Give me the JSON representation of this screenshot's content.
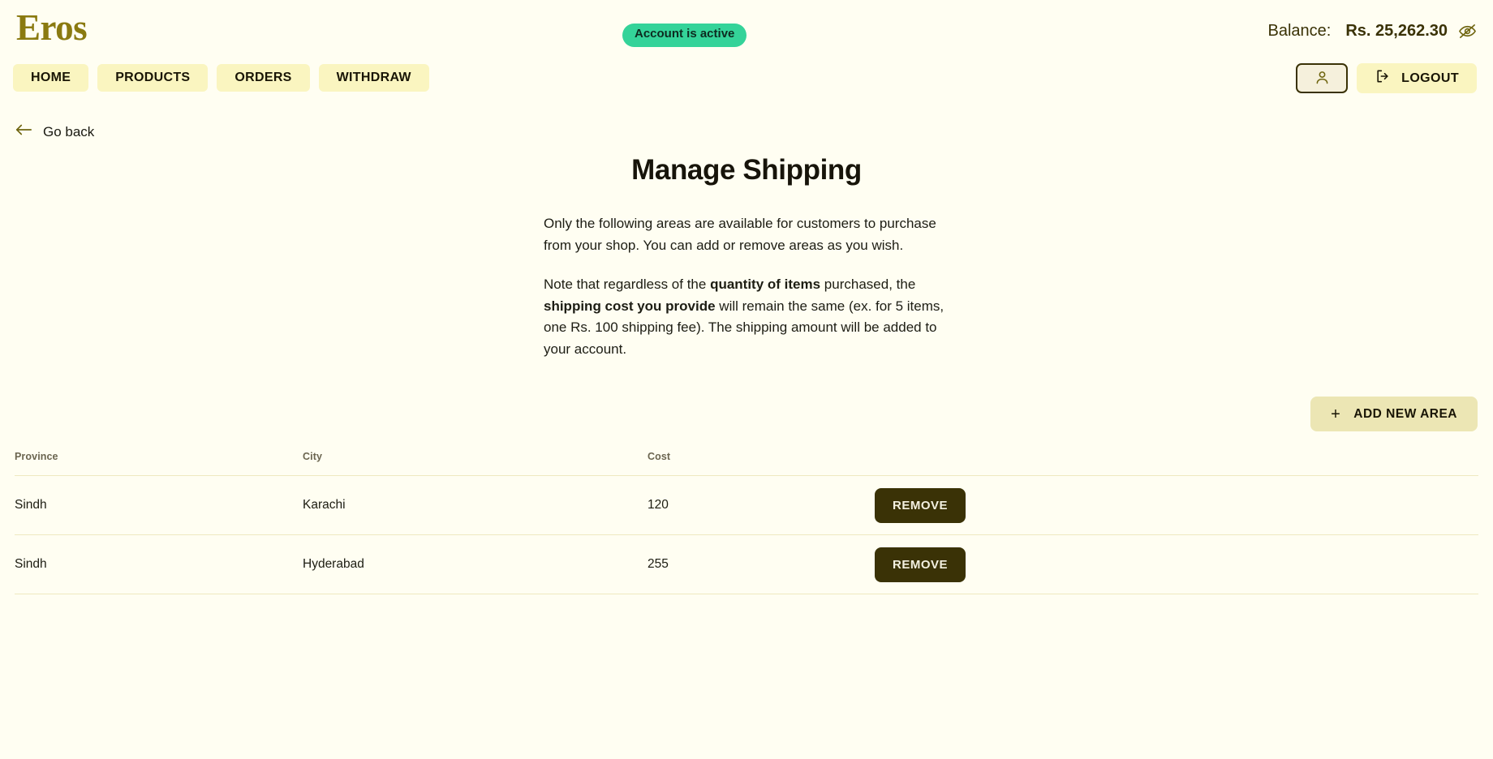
{
  "brand": "Eros",
  "header": {
    "status_badge": "Account is active",
    "balance_label": "Balance:",
    "balance_amount": "Rs. 25,262.30",
    "hide_balance_icon": "eye-off-icon",
    "nav": [
      {
        "label": "HOME"
      },
      {
        "label": "PRODUCTS"
      },
      {
        "label": "ORDERS"
      },
      {
        "label": "WITHDRAW"
      }
    ],
    "profile_icon": "user-icon",
    "logout_label": "LOGOUT",
    "logout_icon": "logout-icon"
  },
  "back": {
    "label": "Go back",
    "icon": "arrow-left-icon"
  },
  "main": {
    "title": "Manage Shipping",
    "paragraph1": "Only the following areas are available for customers to purchase from your shop. You can add or remove areas as you wish.",
    "paragraph2": {
      "part1": "Note that regardless of the ",
      "bold1": "quantity of items",
      "part2": " purchased, the ",
      "bold2": "shipping cost you provide",
      "part3": " will remain the same (ex. for 5 items, one Rs. 100 shipping fee). The shipping amount will be added to your account."
    },
    "add_area_label": "ADD NEW AREA",
    "add_area_icon": "plus-icon"
  },
  "table": {
    "columns": {
      "province": "Province",
      "city": "City",
      "cost": "Cost"
    },
    "rows": [
      {
        "province": "Sindh",
        "city": "Karachi",
        "cost": "120",
        "action": "REMOVE"
      },
      {
        "province": "Sindh",
        "city": "Hyderabad",
        "cost": "255",
        "action": "REMOVE"
      }
    ]
  },
  "colors": {
    "background": "#fffef2",
    "brand": "#8a7a10",
    "nav_button": "#faf5c0",
    "status_badge": "#34d399",
    "dark_button": "#3a3206",
    "divider": "#efe9c0",
    "add_button": "#ece6b4"
  }
}
